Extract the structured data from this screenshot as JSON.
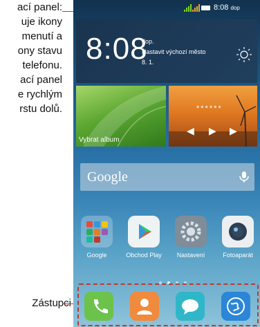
{
  "annotations": {
    "notification_panel_lines": [
      "ací panel:",
      "uje ikony",
      "menutí a",
      "ony stavu",
      "telefonu.",
      "ací panel",
      "e rychlým",
      "rstu dolů."
    ],
    "shortcuts_label": "Zástupci"
  },
  "status_bar": {
    "time": "8:08",
    "suffix": "dop",
    "icons": [
      "signal-icon",
      "signal-icon",
      "battery-icon"
    ]
  },
  "weather_widget": {
    "time": "8:08",
    "period": "dop.",
    "city_prompt": "Nastavit výchozí město",
    "date": "8. 1.",
    "icon": "sun-icon"
  },
  "album_widget": {
    "label": "Vybrat album"
  },
  "music_widget": {
    "title": "******",
    "controls": [
      "previous-icon",
      "play-icon",
      "next-icon"
    ]
  },
  "search_bar": {
    "label": "Google",
    "icon": "microphone-icon"
  },
  "apps": [
    {
      "label": "Google",
      "icon": "google-folder-icon"
    },
    {
      "label": "Obchod Play",
      "icon": "play-store-icon"
    },
    {
      "label": "Nastavení",
      "icon": "settings-icon"
    },
    {
      "label": "Fotoaparát",
      "icon": "camera-icon"
    }
  ],
  "page_indicator": {
    "count": 4,
    "active": 1
  },
  "dock": [
    {
      "icon": "phone-icon"
    },
    {
      "icon": "contacts-icon"
    },
    {
      "icon": "messages-icon"
    },
    {
      "icon": "browser-icon"
    }
  ],
  "colors": {
    "annotation_line": "#c0392b",
    "dock_phone": "#6cc24a",
    "dock_contacts": "#f08a3c",
    "dock_messages": "#2fb7c9",
    "dock_browser": "#2b86d8"
  }
}
